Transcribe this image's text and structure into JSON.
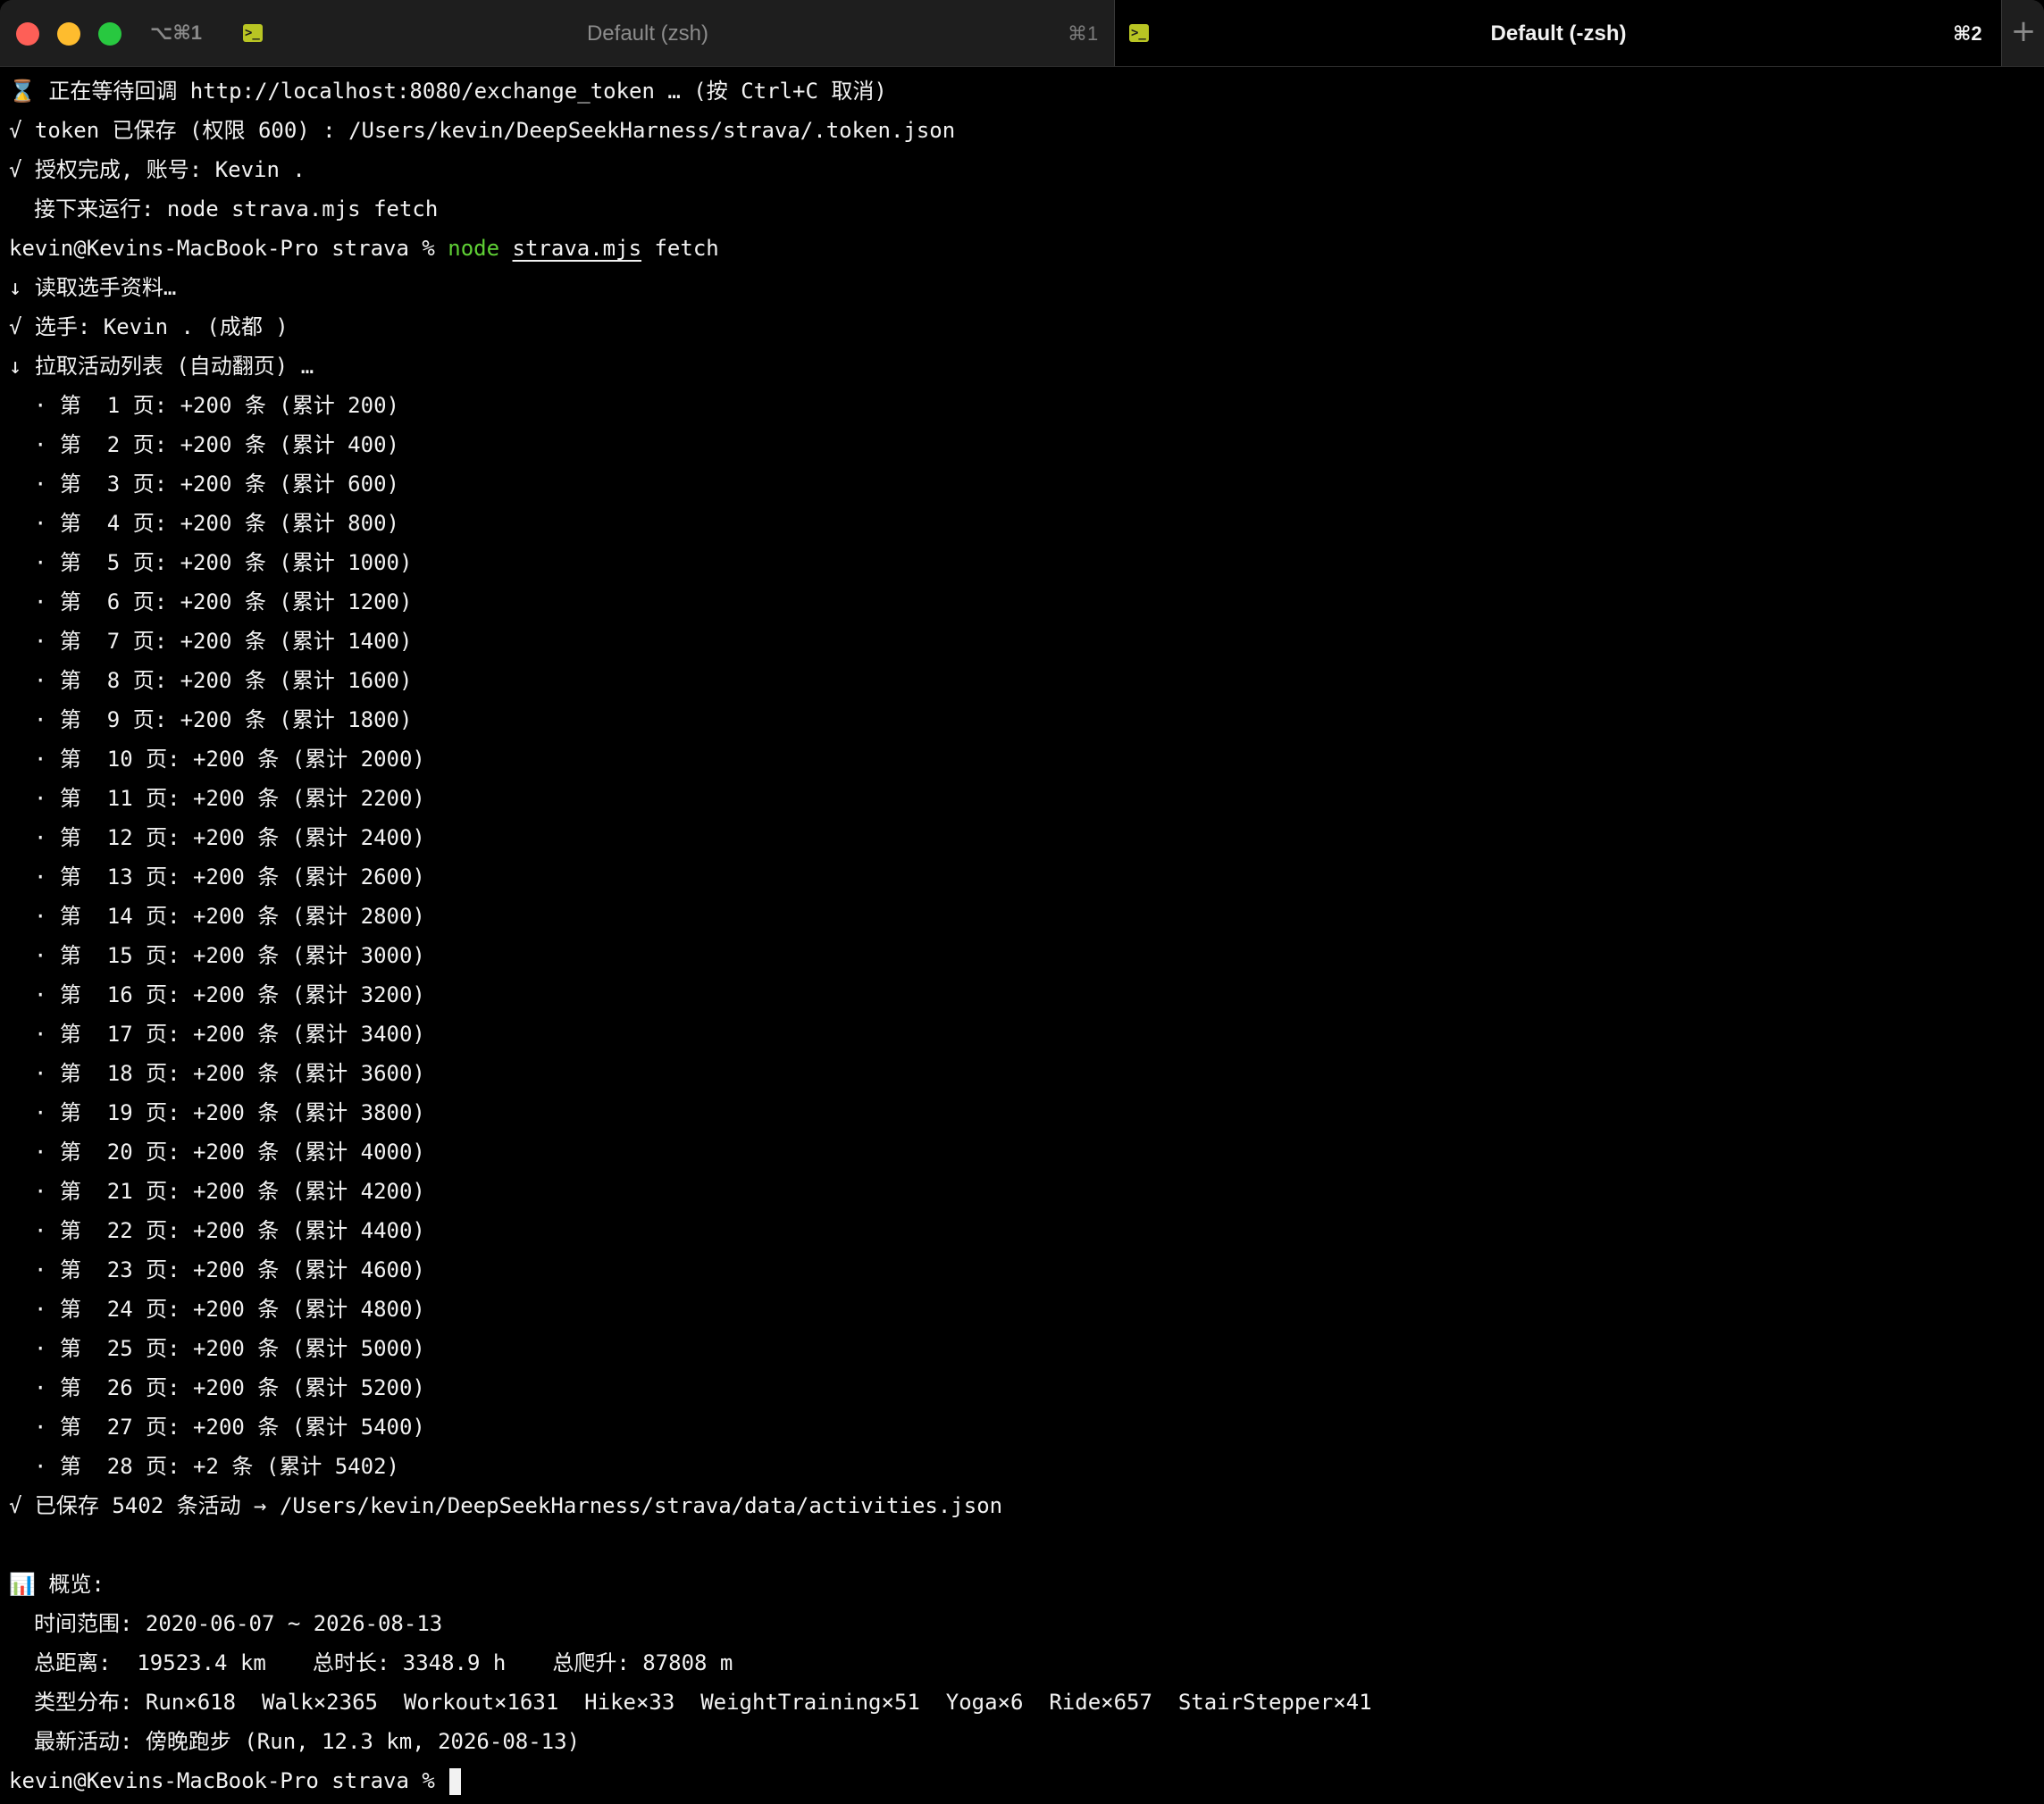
{
  "tabbar": {
    "left_shortcut": "⌥⌘1",
    "tabs": [
      {
        "title": "Default (zsh)",
        "shortcut": "⌘1"
      },
      {
        "title": "Default (-zsh)",
        "shortcut": "⌘2"
      }
    ],
    "new_tab_label": "+"
  },
  "terminal": {
    "waiting_line": "⌛ 正在等待回调 http://localhost:8080/exchange_token … (按 Ctrl+C 取消)",
    "token_saved": "√ token 已保存 (权限 600) : /Users/kevin/DeepSeekHarness/strava/.token.json",
    "auth_done": "√ 授权完成, 账号: Kevin .",
    "next_step": "接下来运行: node strava.mjs fetch",
    "prompt": "kevin@Kevins-MacBook-Pro strava %",
    "command": {
      "cmd": "node",
      "arg1": "strava.mjs",
      "arg2": "fetch"
    },
    "read_profile": "↓ 读取选手资料…",
    "athlete": "√ 选手: Kevin . (成都 )",
    "fetch_list": "↓ 拉取活动列表 (自动翻页) …",
    "pages": [
      "· 第  1 页: +200 条 (累计 200)",
      "· 第  2 页: +200 条 (累计 400)",
      "· 第  3 页: +200 条 (累计 600)",
      "· 第  4 页: +200 条 (累计 800)",
      "· 第  5 页: +200 条 (累计 1000)",
      "· 第  6 页: +200 条 (累计 1200)",
      "· 第  7 页: +200 条 (累计 1400)",
      "· 第  8 页: +200 条 (累计 1600)",
      "· 第  9 页: +200 条 (累计 1800)",
      "· 第  10 页: +200 条 (累计 2000)",
      "· 第  11 页: +200 条 (累计 2200)",
      "· 第  12 页: +200 条 (累计 2400)",
      "· 第  13 页: +200 条 (累计 2600)",
      "· 第  14 页: +200 条 (累计 2800)",
      "· 第  15 页: +200 条 (累计 3000)",
      "· 第  16 页: +200 条 (累计 3200)",
      "· 第  17 页: +200 条 (累计 3400)",
      "· 第  18 页: +200 条 (累计 3600)",
      "· 第  19 页: +200 条 (累计 3800)",
      "· 第  20 页: +200 条 (累计 4000)",
      "· 第  21 页: +200 条 (累计 4200)",
      "· 第  22 页: +200 条 (累计 4400)",
      "· 第  23 页: +200 条 (累计 4600)",
      "· 第  24 页: +200 条 (累计 4800)",
      "· 第  25 页: +200 条 (累计 5000)",
      "· 第  26 页: +200 条 (累计 5200)",
      "· 第  27 页: +200 条 (累计 5400)",
      "· 第  28 页: +2 条 (累计 5402)"
    ],
    "saved": "√ 已保存 5402 条活动 → /Users/kevin/DeepSeekHarness/strava/data/activities.json",
    "overview_title": "📊 概览:",
    "time_range": "时间范围: 2020-06-07 ~ 2026-08-13",
    "total_distance": "总距离:  19523.4 km",
    "total_duration": "总时长: 3348.9 h",
    "total_climb": "总爬升: 87808 m",
    "type_distribution": "类型分布: Run×618  Walk×2365  Workout×1631  Hike×33  WeightTraining×51  Yoga×6  Ride×657  StairStepper×41",
    "latest_activity": "最新活动: 傍晚跑步 (Run, 12.3 km, 2026-08-13)"
  }
}
